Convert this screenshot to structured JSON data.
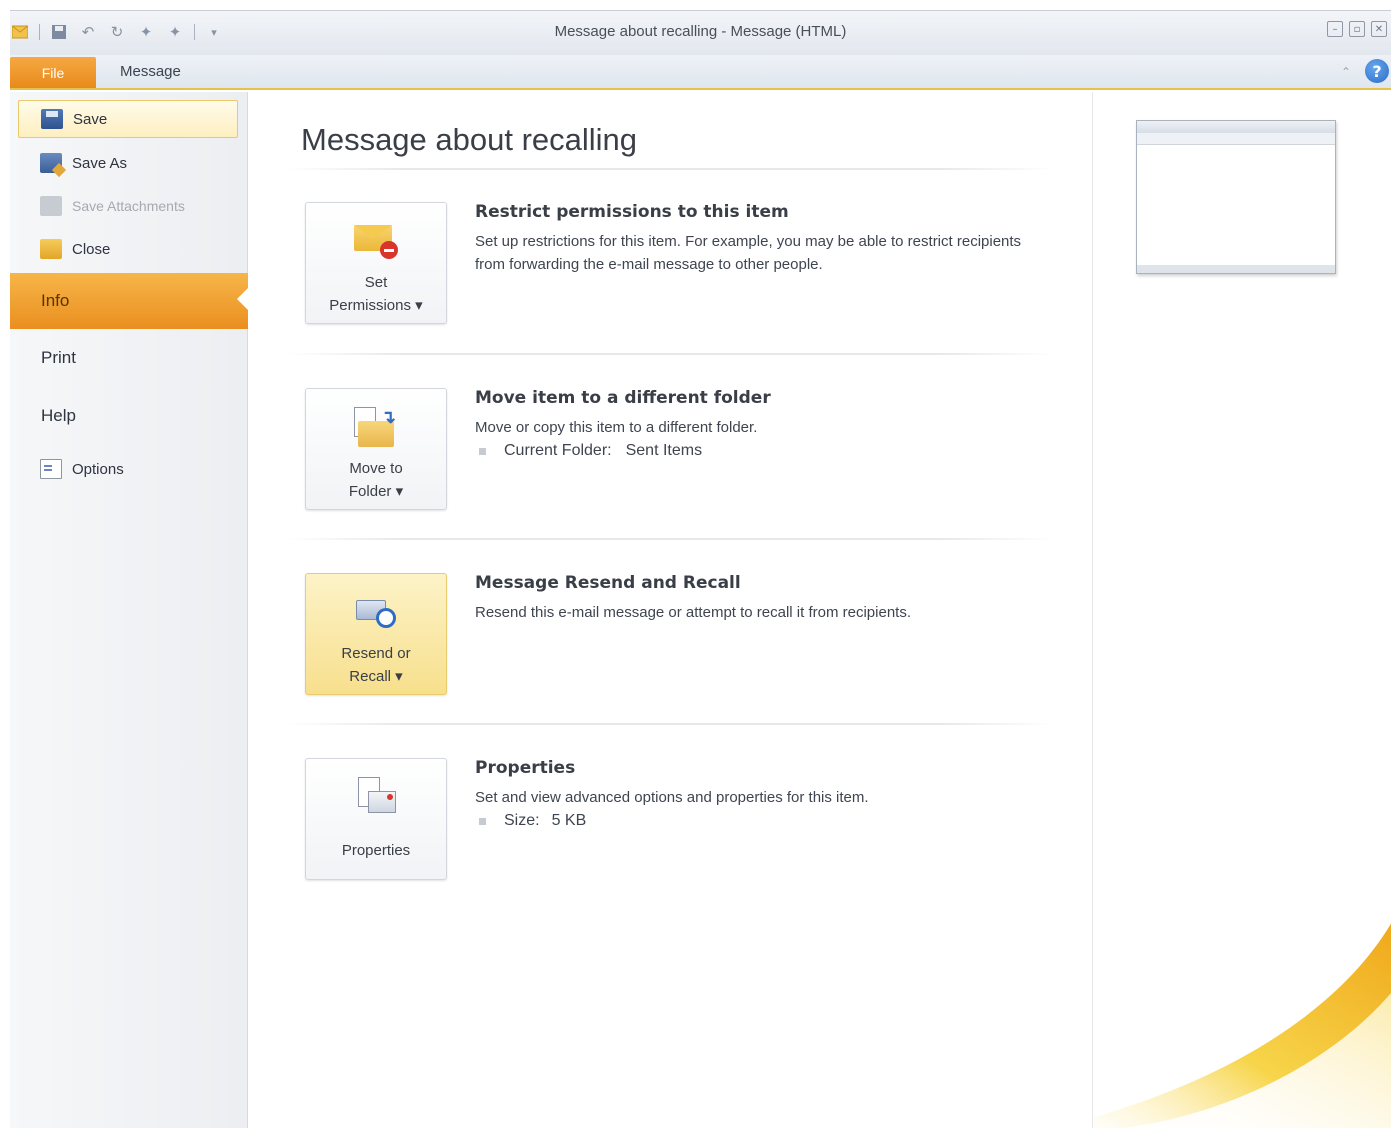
{
  "window": {
    "title": "Message about recalling - Message (HTML)"
  },
  "ribbon": {
    "tabs": [
      {
        "label": "File",
        "active": true
      },
      {
        "label": "Message",
        "active": false
      }
    ]
  },
  "nav": {
    "commands": [
      {
        "label": "Save",
        "icon": "save-icon",
        "state": "hovered"
      },
      {
        "label": "Save As",
        "icon": "save-as-icon",
        "state": "normal"
      },
      {
        "label": "Save Attachments",
        "icon": "save-attachments-icon",
        "state": "disabled"
      },
      {
        "label": "Close",
        "icon": "close-folder-icon",
        "state": "normal"
      }
    ],
    "items": [
      {
        "label": "Info",
        "active": true
      },
      {
        "label": "Print",
        "active": false
      },
      {
        "label": "Help",
        "active": false
      }
    ],
    "options_label": "Options"
  },
  "main": {
    "title": "Message about recalling",
    "sections": [
      {
        "button": {
          "line1": "Set",
          "line2": "Permissions ▾",
          "icon": "envelope-restrict-icon"
        },
        "title": "Restrict permissions to this item",
        "description": "Set up restrictions for this item. For example, you may be able to restrict recipients from forwarding the e-mail message to other people."
      },
      {
        "button": {
          "line1": "Move to",
          "line2": "Folder ▾",
          "icon": "move-folder-icon"
        },
        "title": "Move item to a different folder",
        "description": "Move or copy this item to a different folder.",
        "detail": {
          "label": "Current Folder:",
          "value": "Sent Items"
        }
      },
      {
        "button": {
          "line1": "Resend or",
          "line2": "Recall ▾",
          "icon": "resend-recall-icon",
          "state": "hovered"
        },
        "title": "Message Resend and Recall",
        "description": "Resend this e-mail message or attempt to recall it from recipients."
      },
      {
        "button": {
          "line1": "Properties",
          "line2": "",
          "icon": "properties-icon"
        },
        "title": "Properties",
        "description": "Set and view advanced options and properties for this item.",
        "detail": {
          "label": "Size:",
          "value": "5 KB"
        }
      }
    ]
  },
  "colors": {
    "file_tab": "#ea8f20",
    "info_active": "#f0a535",
    "hover_button": "#f7df8c",
    "accent_blue": "#2f6dc4"
  }
}
